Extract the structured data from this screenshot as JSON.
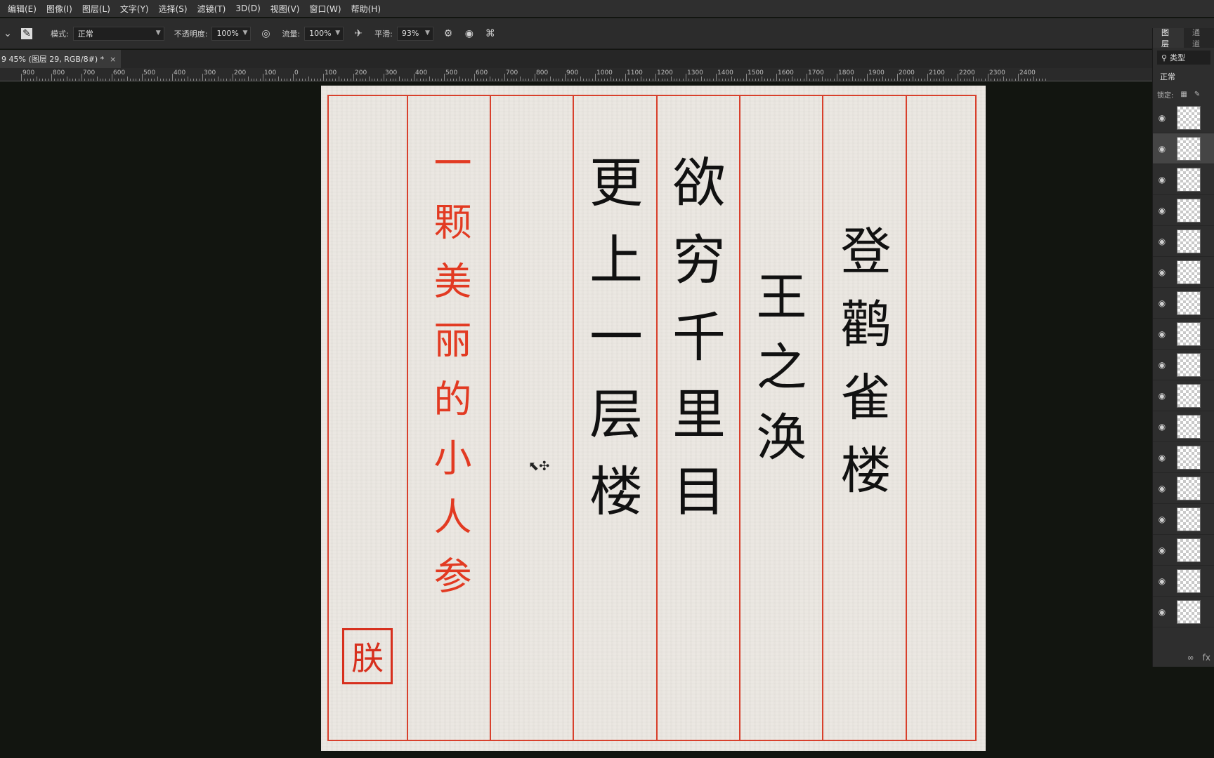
{
  "menu": [
    "编辑(E)",
    "图像(I)",
    "图层(L)",
    "文字(Y)",
    "选择(S)",
    "滤镜(T)",
    "3D(D)",
    "视图(V)",
    "窗口(W)",
    "帮助(H)"
  ],
  "options": {
    "mode_label": "模式:",
    "mode_value": "正常",
    "opacity_label": "不透明度:",
    "opacity_value": "100%",
    "flow_label": "流量:",
    "flow_value": "100%",
    "smooth_label": "平滑:",
    "smooth_value": "93%"
  },
  "tab": {
    "title": "9 45% (图层 29, RGB/8#) *",
    "close": "×"
  },
  "ruler": [
    "900",
    "800",
    "700",
    "600",
    "500",
    "400",
    "300",
    "200",
    "100",
    "0",
    "100",
    "200",
    "300",
    "400",
    "500",
    "600",
    "700",
    "800",
    "900",
    "1000",
    "1100",
    "1200",
    "1300",
    "1400",
    "1500",
    "1600",
    "1700",
    "1800",
    "1900",
    "2000",
    "2100",
    "2200",
    "2300",
    "2400"
  ],
  "artwork": {
    "title": "登鹳雀楼",
    "author": "王之涣",
    "line1": "欲穷千里目",
    "line2": "更上一层楼",
    "signature": "一颗美丽的小人参",
    "seal": "朕"
  },
  "layers_panel": {
    "tabs": [
      "图层",
      "通道"
    ],
    "search": "类型",
    "blend": "正常",
    "lock_label": "锁定:",
    "layer_count": 17,
    "fx": "fx"
  },
  "colors": {
    "ink": "#111111",
    "red": "#e23a22",
    "paper": "#ebe7e1",
    "grid": "#d8402c"
  }
}
